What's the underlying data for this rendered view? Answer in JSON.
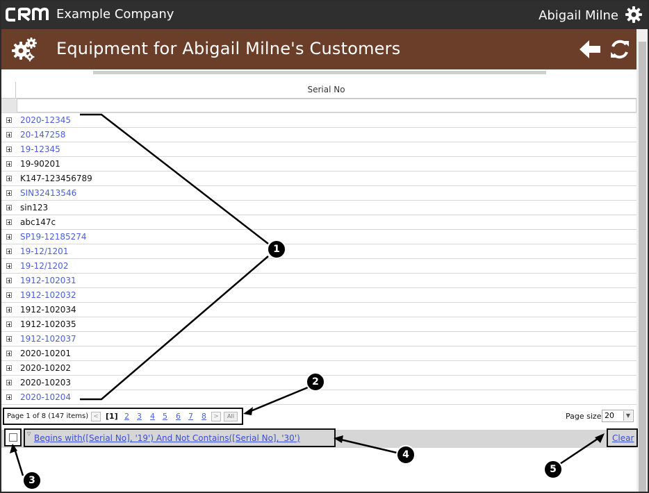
{
  "app": {
    "company": "Example Company",
    "user": "Abigail Milne",
    "page_title": "Equipment for Abigail Milne's Customers"
  },
  "grid": {
    "column_header": "Serial No",
    "rows": [
      {
        "serial": "2020-12345",
        "link": true
      },
      {
        "serial": "20-147258",
        "link": true
      },
      {
        "serial": "19-12345",
        "link": true
      },
      {
        "serial": "19-90201",
        "link": false
      },
      {
        "serial": "K147-123456789",
        "link": false
      },
      {
        "serial": "SIN32413546",
        "link": true
      },
      {
        "serial": "sin123",
        "link": false
      },
      {
        "serial": "abc147c",
        "link": false
      },
      {
        "serial": "SP19-12185274",
        "link": true
      },
      {
        "serial": "19-12/1201",
        "link": true
      },
      {
        "serial": "19-12/1202",
        "link": true
      },
      {
        "serial": "1912-102031",
        "link": true
      },
      {
        "serial": "1912-102032",
        "link": true
      },
      {
        "serial": "1912-102034",
        "link": false
      },
      {
        "serial": "1912-102035",
        "link": false
      },
      {
        "serial": "1912-102037",
        "link": true
      },
      {
        "serial": "2020-10201",
        "link": false
      },
      {
        "serial": "2020-10202",
        "link": false
      },
      {
        "serial": "2020-10203",
        "link": false
      },
      {
        "serial": "2020-10204",
        "link": true
      }
    ]
  },
  "pager": {
    "info": "Page 1 of 8 (147 items)",
    "prev": "<",
    "current": "[1]",
    "pages": [
      "2",
      "3",
      "4",
      "5",
      "6",
      "7",
      "8"
    ],
    "next": ">",
    "all": "All",
    "page_size_label": "Page size:",
    "page_size": "20"
  },
  "filter": {
    "expression": "Begins with([Serial No], '19') And Not Contains([Serial No], '30')",
    "clear": "Clear"
  },
  "callouts": [
    "1",
    "2",
    "3",
    "4",
    "5"
  ],
  "colors": {
    "topbar": "#2f2f2f",
    "titlebar": "#6b3e2a",
    "link": "#4a5fd6"
  }
}
